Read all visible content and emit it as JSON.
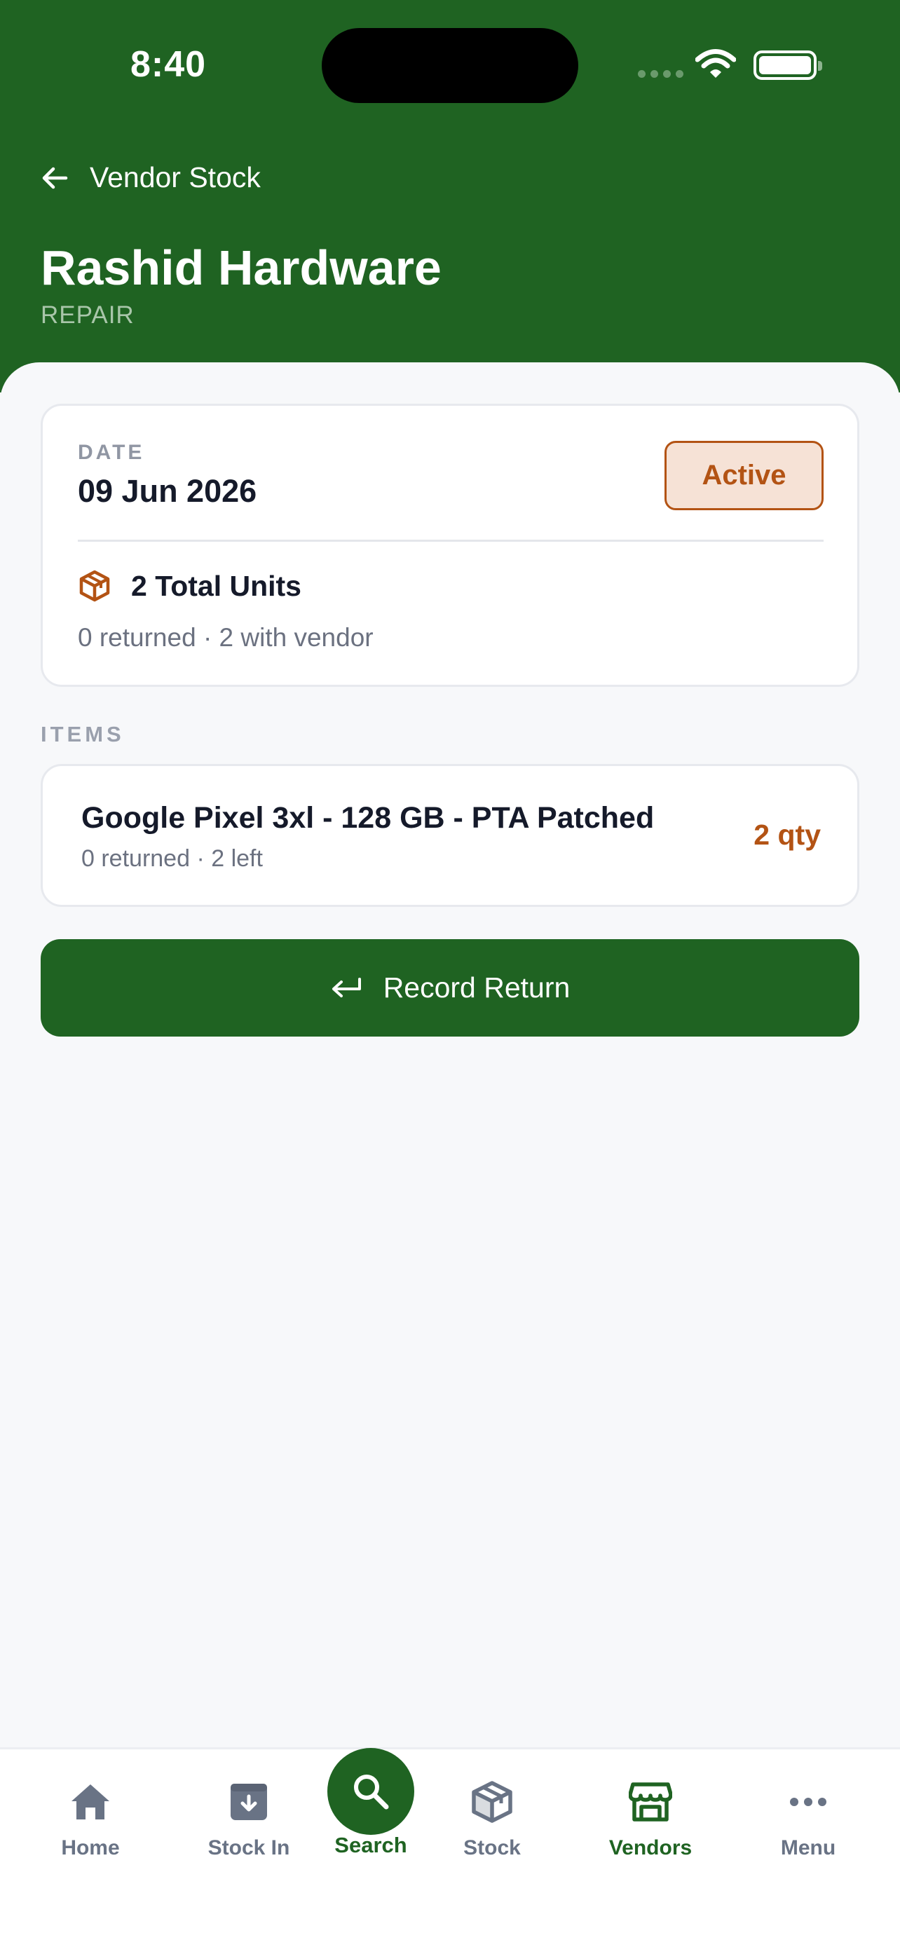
{
  "status": {
    "time": "8:40"
  },
  "header": {
    "back_label": "Vendor Stock",
    "vendor_name": "Rashid Hardware",
    "vendor_type": "REPAIR"
  },
  "summary": {
    "date_label": "DATE",
    "date_value": "09 Jun 2026",
    "status_badge": "Active",
    "total_units": "2 Total Units",
    "units_detail": "0 returned · 2 with vendor"
  },
  "items_section": {
    "label": "ITEMS",
    "items": [
      {
        "name": "Google Pixel 3xl - 128 GB - PTA Patched",
        "detail": "0 returned · 2 left",
        "qty": "2 qty"
      }
    ]
  },
  "actions": {
    "record_return": "Record Return"
  },
  "bottom_nav": {
    "home": "Home",
    "stock_in": "Stock In",
    "search": "Search",
    "stock": "Stock",
    "vendors": "Vendors",
    "menu": "Menu",
    "active": "vendors"
  },
  "colors": {
    "brand_green": "#1f6322",
    "accent_orange": "#b35314",
    "badge_bg": "#f6e2d6"
  }
}
